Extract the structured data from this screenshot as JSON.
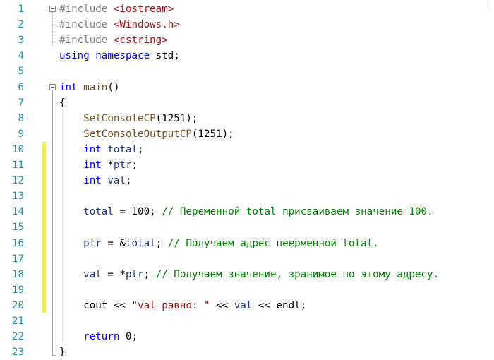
{
  "editor": {
    "line_numbers": [
      "1",
      "2",
      "3",
      "4",
      "5",
      "6",
      "7",
      "8",
      "9",
      "10",
      "11",
      "12",
      "13",
      "14",
      "15",
      "16",
      "17",
      "18",
      "19",
      "20",
      "21",
      "22",
      "23"
    ],
    "lines": [
      [
        {
          "t": "#include ",
          "c": "pp"
        },
        {
          "t": "<iostream>",
          "c": "inc"
        }
      ],
      [
        {
          "t": "#include ",
          "c": "pp"
        },
        {
          "t": "<Windows.h>",
          "c": "inc"
        }
      ],
      [
        {
          "t": "#include ",
          "c": "pp"
        },
        {
          "t": "<cstring>",
          "c": "inc"
        }
      ],
      [
        {
          "t": "using",
          "c": "kw"
        },
        {
          "t": " ",
          "c": ""
        },
        {
          "t": "namespace",
          "c": "kw"
        },
        {
          "t": " std;",
          "c": ""
        }
      ],
      [],
      [
        {
          "t": "int",
          "c": "kw"
        },
        {
          "t": " ",
          "c": ""
        },
        {
          "t": "main",
          "c": "fn"
        },
        {
          "t": "()",
          "c": ""
        }
      ],
      [
        {
          "t": "{",
          "c": ""
        }
      ],
      [
        {
          "t": "    ",
          "c": ""
        },
        {
          "t": "SetConsoleCP",
          "c": "fn"
        },
        {
          "t": "(1251);",
          "c": ""
        }
      ],
      [
        {
          "t": "    ",
          "c": ""
        },
        {
          "t": "SetConsoleOutputCP",
          "c": "fn"
        },
        {
          "t": "(1251);",
          "c": ""
        }
      ],
      [
        {
          "t": "    ",
          "c": ""
        },
        {
          "t": "int",
          "c": "kw"
        },
        {
          "t": " ",
          "c": ""
        },
        {
          "t": "total",
          "c": "var"
        },
        {
          "t": ";",
          "c": ""
        }
      ],
      [
        {
          "t": "    ",
          "c": ""
        },
        {
          "t": "int",
          "c": "kw"
        },
        {
          "t": " *",
          "c": ""
        },
        {
          "t": "ptr",
          "c": "var"
        },
        {
          "t": ";",
          "c": ""
        }
      ],
      [
        {
          "t": "    ",
          "c": ""
        },
        {
          "t": "int",
          "c": "kw"
        },
        {
          "t": " ",
          "c": ""
        },
        {
          "t": "val",
          "c": "var"
        },
        {
          "t": ";",
          "c": ""
        }
      ],
      [],
      [
        {
          "t": "    ",
          "c": ""
        },
        {
          "t": "total",
          "c": "var"
        },
        {
          "t": " = 100; ",
          "c": ""
        },
        {
          "t": "// Переменной total присваиваем значение 100.",
          "c": "cm"
        }
      ],
      [],
      [
        {
          "t": "    ",
          "c": ""
        },
        {
          "t": "ptr",
          "c": "var"
        },
        {
          "t": " = &",
          "c": ""
        },
        {
          "t": "total",
          "c": "var"
        },
        {
          "t": "; ",
          "c": ""
        },
        {
          "t": "// Получаем адрес пеерменной total.",
          "c": "cm"
        }
      ],
      [],
      [
        {
          "t": "    ",
          "c": ""
        },
        {
          "t": "val",
          "c": "var"
        },
        {
          "t": " = *",
          "c": ""
        },
        {
          "t": "ptr",
          "c": "var"
        },
        {
          "t": "; ",
          "c": ""
        },
        {
          "t": "// Получаем значение, зранимое по этому адресу.",
          "c": "cm"
        }
      ],
      [],
      [
        {
          "t": "    cout << ",
          "c": ""
        },
        {
          "t": "\"val равно: \"",
          "c": "str"
        },
        {
          "t": " << ",
          "c": ""
        },
        {
          "t": "val",
          "c": "var"
        },
        {
          "t": " << endl;",
          "c": ""
        }
      ],
      [],
      [
        {
          "t": "    ",
          "c": ""
        },
        {
          "t": "return",
          "c": "kw"
        },
        {
          "t": " 0;",
          "c": ""
        }
      ],
      [
        {
          "t": "}",
          "c": ""
        }
      ]
    ],
    "collapse_lines": [
      1,
      6
    ],
    "changed_line_range": [
      10,
      20
    ],
    "colors": {
      "line_number": "#2b91af",
      "keyword": "#0000ff",
      "preprocessor": "#808080",
      "include_path": "#a31515",
      "function": "#74531f",
      "variable": "#1f377f",
      "comment": "#008000",
      "string": "#a31515",
      "change_bar": "#f1ea63"
    }
  }
}
